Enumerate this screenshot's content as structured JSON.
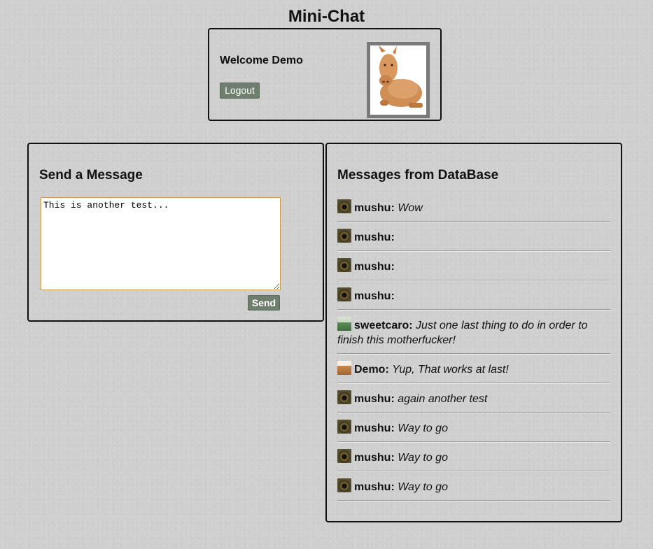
{
  "app": {
    "title": "Mini-Chat"
  },
  "user_panel": {
    "welcome_text": "Welcome Demo",
    "logout_label": "Logout",
    "avatar_icon": "pig-avatar-icon"
  },
  "send_panel": {
    "title": "Send a Message",
    "textarea_value": "This is another test...",
    "send_label": "Send"
  },
  "messages_panel": {
    "title": "Messages from DataBase",
    "messages": [
      {
        "user": "mushu:",
        "text": "Wow",
        "icon": "eye-avatar-icon"
      },
      {
        "user": "mushu:",
        "text": "",
        "icon": "eye-avatar-icon"
      },
      {
        "user": "mushu:",
        "text": "",
        "icon": "eye-avatar-icon"
      },
      {
        "user": "mushu:",
        "text": "",
        "icon": "eye-avatar-icon"
      },
      {
        "user": "sweetcaro:",
        "text": "Just one last thing to do in order to finish this motherfucker!",
        "icon": "girl-avatar-icon"
      },
      {
        "user": "Demo:",
        "text": "Yup, That works at last!",
        "icon": "pig-avatar-icon"
      },
      {
        "user": "mushu:",
        "text": "again another test",
        "icon": "eye-avatar-icon"
      },
      {
        "user": "mushu:",
        "text": "Way to go",
        "icon": "eye-avatar-icon"
      },
      {
        "user": "mushu:",
        "text": "Way to go",
        "icon": "eye-avatar-icon"
      },
      {
        "user": "mushu:",
        "text": "Way to go",
        "icon": "eye-avatar-icon"
      }
    ]
  },
  "colors": {
    "background": "#cfcfcf",
    "button": "#6f7f6f",
    "textarea_border": "#c59a4a",
    "panel_border": "#111111"
  }
}
